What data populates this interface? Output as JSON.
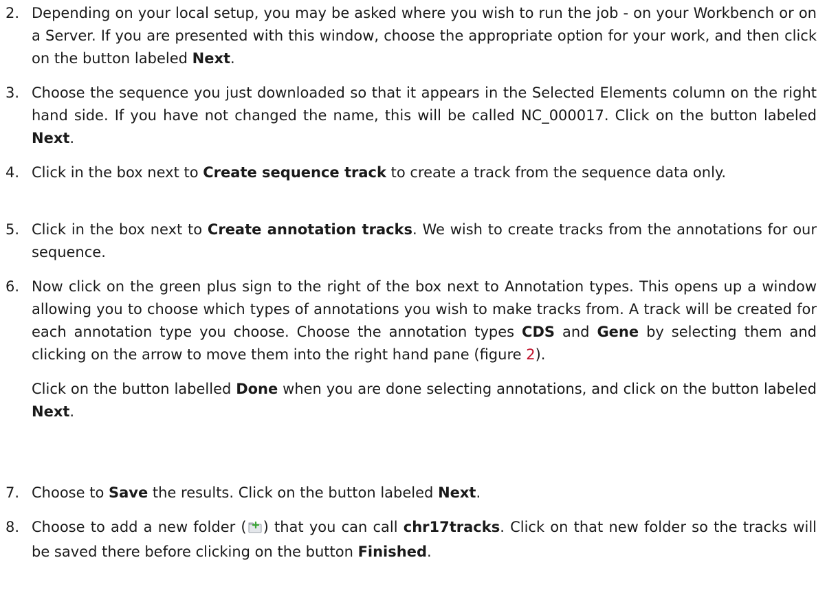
{
  "steps": [
    {
      "number": "2.",
      "parts": [
        {
          "text": "Depending on your local setup, you may be asked where you wish to run the job - on your Workbench or on a Server. If you are presented with this window, choose the appropriate option for your work, and then click on the button labeled "
        },
        {
          "bold": "Next"
        },
        {
          "text": "."
        }
      ]
    },
    {
      "number": "3.",
      "parts": [
        {
          "text": "Choose the sequence you just downloaded so that it appears in the Selected Elements column on the right hand side.  If you have not changed the name, this will be called NC_000017. Click on the button labeled "
        },
        {
          "bold": "Next"
        },
        {
          "text": "."
        }
      ]
    },
    {
      "number": "4.",
      "parts": [
        {
          "text": "Click in the box next to "
        },
        {
          "bold": "Create sequence track"
        },
        {
          "text": " to create a track from the sequence data only."
        }
      ]
    },
    {
      "number": "5.",
      "parts": [
        {
          "text": "Click in the box next to "
        },
        {
          "bold": "Create annotation tracks"
        },
        {
          "text": ".  We wish to create tracks from the annotations for our sequence."
        }
      ]
    },
    {
      "number": "6.",
      "parts": [
        {
          "text": "Now click on the green plus sign to the right of the box next to Annotation types. This opens up a window allowing you to choose which types of annotations you wish to make tracks from. A track will be created for each annotation type you choose. Choose the annotation types "
        },
        {
          "bold": "CDS"
        },
        {
          "text": " and "
        },
        {
          "bold": "Gene"
        },
        {
          "text": " by selecting them and clicking on the arrow to move them into the right hand pane (figure "
        },
        {
          "figref": "2"
        },
        {
          "text": ")."
        }
      ],
      "parts2": [
        {
          "text": "Click on the button labelled "
        },
        {
          "bold": "Done"
        },
        {
          "text": " when you are done selecting annotations, and click on the button labeled "
        },
        {
          "bold": "Next"
        },
        {
          "text": "."
        }
      ]
    },
    {
      "number": "7.",
      "parts": [
        {
          "text": "Choose to "
        },
        {
          "bold": "Save"
        },
        {
          "text": " the results. Click on the button labeled "
        },
        {
          "bold": "Next"
        },
        {
          "text": "."
        }
      ]
    },
    {
      "number": "8.",
      "parts": [
        {
          "text": "Choose to add a new folder  ("
        },
        {
          "icon": "new-folder-icon"
        },
        {
          "text": ") that you can call "
        },
        {
          "bold": "chr17tracks"
        },
        {
          "text": ". Click on that new folder so the tracks will be saved there before clicking on the button "
        },
        {
          "bold": "Finished"
        },
        {
          "text": "."
        }
      ]
    }
  ],
  "colors": {
    "text": "#1a1a1a",
    "link": "#c0102a",
    "icon_plus": "#3aa535"
  }
}
